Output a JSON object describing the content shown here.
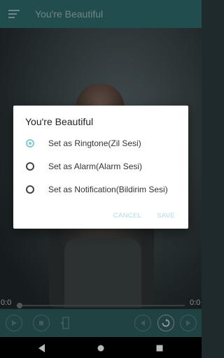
{
  "appbar": {
    "title": "You're Beautiful",
    "menu_icon": "menu-icon"
  },
  "dialog": {
    "title": "You're Beautiful",
    "options": [
      {
        "label": "Set as Ringtone(Zil Sesi)",
        "selected": true
      },
      {
        "label": "Set as Alarm(Alarm Sesi)",
        "selected": false
      },
      {
        "label": "Set as Notification(Bildirim Sesi)",
        "selected": false
      }
    ],
    "actions": {
      "cancel_label": "CANCEL",
      "save_label": "SAVE"
    },
    "accent_color": "#82c9d4"
  },
  "player": {
    "time_elapsed": "0:0",
    "time_total": "0:0",
    "progress": 0,
    "controls": [
      "play-icon",
      "stop-icon",
      "exit-icon",
      "previous-icon",
      "repeat-icon",
      "next-icon"
    ]
  },
  "nav": {
    "icons": [
      "back-icon",
      "home-icon",
      "recents-icon"
    ]
  },
  "colors": {
    "appbar": "#2f6b6c",
    "controls_bar": "#2f5c5d"
  }
}
